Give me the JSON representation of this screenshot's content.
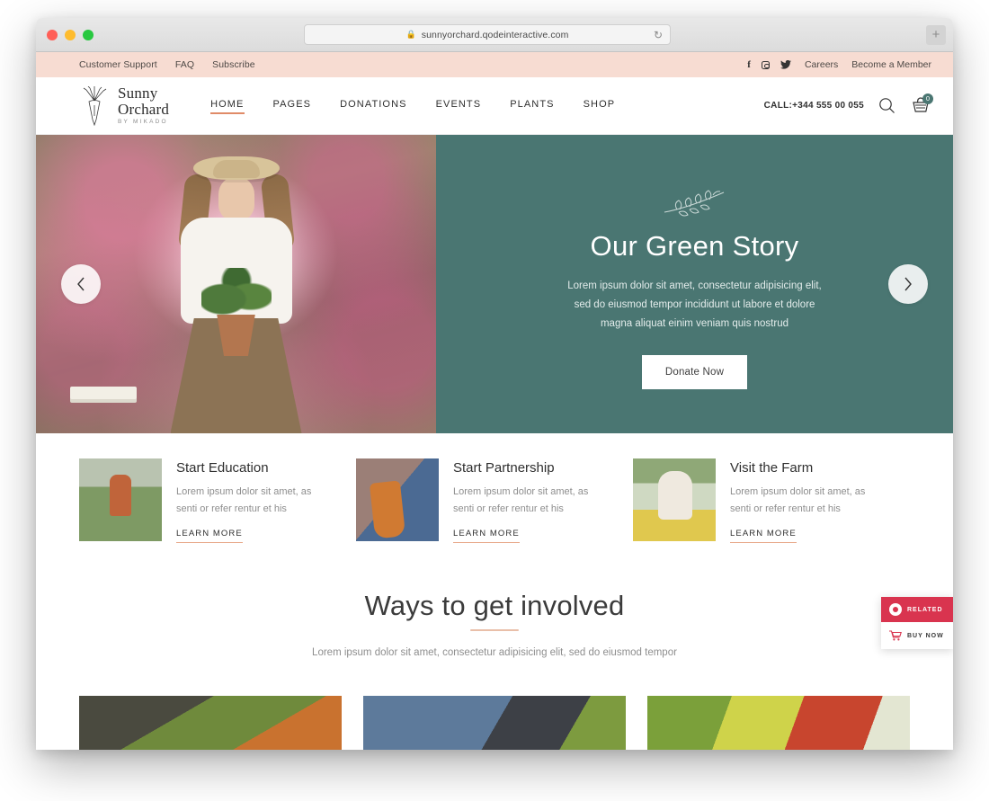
{
  "browser": {
    "url": "sunnyorchard.qodeinteractive.com",
    "lock_icon": "lock-icon",
    "reload_icon": "reload-icon",
    "newtab_label": "+"
  },
  "topbar": {
    "links": [
      "Customer Support",
      "FAQ",
      "Subscribe"
    ],
    "social": [
      "facebook-icon",
      "instagram-icon",
      "twitter-icon"
    ],
    "right_links": [
      "Careers",
      "Become a Member"
    ],
    "bg_color": "#f7dcd2"
  },
  "header": {
    "logo": {
      "line1": "Sunny",
      "line2": "Orchard",
      "tagline": "BY MIKADO",
      "mark": "carrot-icon"
    },
    "nav": [
      {
        "label": "HOME",
        "active": true
      },
      {
        "label": "PAGES",
        "active": false
      },
      {
        "label": "DONATIONS",
        "active": false
      },
      {
        "label": "EVENTS",
        "active": false
      },
      {
        "label": "PLANTS",
        "active": false
      },
      {
        "label": "SHOP",
        "active": false
      }
    ],
    "phone": "CALL:+344 555 00 055",
    "search_icon": "search-icon",
    "cart_icon": "cart-icon",
    "cart_count": "0",
    "accent_color": "#e08b68",
    "cart_badge_color": "#4a7672"
  },
  "hero": {
    "ornament": "branch-icon",
    "title": "Our Green Story",
    "text": "Lorem ipsum dolor sit amet, consectetur adipisicing elit, sed do eiusmod tempor incididunt ut labore et dolore magna aliquat einim veniam quis nostrud",
    "button": "Donate Now",
    "prev_icon": "chevron-left-icon",
    "next_icon": "chevron-right-icon",
    "panel_color": "#4a7672"
  },
  "features": [
    {
      "title": "Start Education",
      "desc": "Lorem ipsum dolor sit amet, as senti or refer rentur et his",
      "link": "LEARN MORE",
      "image": "woman-walking-field-photo"
    },
    {
      "title": "Start Partnership",
      "desc": "Lorem ipsum dolor sit amet, as senti or refer rentur et his",
      "link": "LEARN MORE",
      "image": "hand-holding-carrots-photo"
    },
    {
      "title": "Visit the Farm",
      "desc": "Lorem ipsum dolor sit amet, as senti or refer rentur et his",
      "link": "LEARN MORE",
      "image": "woman-with-sunflower-photo"
    }
  ],
  "ways": {
    "title": "Ways to get involved",
    "subtitle": "Lorem ipsum dolor sit amet, consectetur adipisicing elit, sed do eiusmod tempor"
  },
  "gallery": [
    {
      "image": "harvested-carrots-soil-photo"
    },
    {
      "image": "farmers-with-carrots-photo"
    },
    {
      "image": "tomatoes-vegetables-photo"
    }
  ],
  "side_widget": {
    "related_label": "RELATED",
    "related_icon": "record-icon",
    "buy_label": "BUY NOW",
    "buy_icon": "cart-icon",
    "related_color": "#d9344f"
  }
}
